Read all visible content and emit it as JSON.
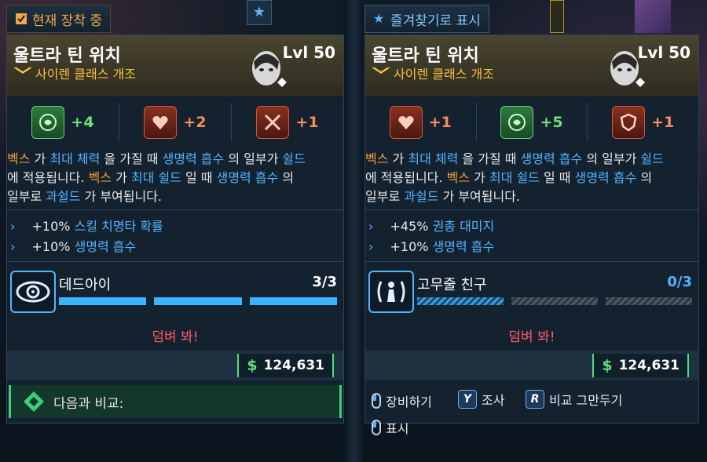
{
  "tabs": {
    "left": "현재 장착 중",
    "right": "즐겨찾기로 표시"
  },
  "left": {
    "title": "울트라 틴 위치",
    "level": "Lvl 50",
    "subtitle": "사이렌 클래스 개조",
    "stats": [
      {
        "icon": "lifesteal-icon",
        "value": "+4",
        "color": "green"
      },
      {
        "icon": "heart-boost-icon",
        "value": "+2",
        "color": "red"
      },
      {
        "icon": "crossed-weapons-icon",
        "value": "+1",
        "color": "red"
      }
    ],
    "description": {
      "t1": "벡스",
      "t2": " 가 ",
      "t3": "최대 체력",
      "t4": " 을 가질 때 ",
      "t5": "생명력 흡수",
      "t6": " 의 일부가 ",
      "t7": "쉴드",
      "t8": "에 적용됩니다. ",
      "t9": "벡스",
      "t10": " 가 ",
      "t11": "최대 쉴드",
      "t12": " 일 때 ",
      "t13": "생명력 흡수",
      "t14": " 의",
      "t15": "일부로 ",
      "t16": "과쉴드",
      "t17": " 가 부여됩니다."
    },
    "bonuses": [
      {
        "prefix": "+10% ",
        "name": "스킬 치명타 확률"
      },
      {
        "prefix": "+10% ",
        "name": "생명력 흡수"
      }
    ],
    "skill": {
      "icon": "eye-target-icon",
      "name": "데드아이",
      "count": "3/3",
      "filled": 3,
      "total": 3
    },
    "taunt": "덤벼 봐!",
    "price": "124,631",
    "currency": "$",
    "compare": "다음과 비교:"
  },
  "right": {
    "title": "울트라 틴 위치",
    "level": "Lvl 50",
    "subtitle": "사이렌 클래스 개조",
    "stats": [
      {
        "icon": "heart-boost-icon",
        "value": "+1",
        "color": "red"
      },
      {
        "icon": "lifesteal-icon",
        "value": "+5",
        "color": "green"
      },
      {
        "icon": "shield-boost-icon",
        "value": "+1",
        "color": "red"
      }
    ],
    "description": {
      "t1": "벡스",
      "t2": " 가 ",
      "t3": "최대 체력",
      "t4": " 을 가질 때 ",
      "t5": "생명력 흡수",
      "t6": " 의 일부가 ",
      "t7": "쉴드",
      "t8": "에 적용됩니다. ",
      "t9": "벡스",
      "t10": " 가 ",
      "t11": "최대 쉴드",
      "t12": " 일 때 ",
      "t13": "생명력 흡수",
      "t14": " 의",
      "t15": "일부로 ",
      "t16": "과쉴드",
      "t17": " 가 부여됩니다."
    },
    "bonuses": [
      {
        "prefix": "+45% ",
        "name": "권총 대미지"
      },
      {
        "prefix": "+10% ",
        "name": "생명력 흡수"
      }
    ],
    "skill": {
      "icon": "person-signal-icon",
      "name": "고무줄 친구",
      "count": "0/3",
      "filled": 0,
      "total": 3
    },
    "taunt": "덤벼 봐!",
    "price": "124,631",
    "currency": "$",
    "controls": {
      "equip": "장비하기",
      "inspect_key": "Y",
      "inspect": "조사",
      "stop_key": "R",
      "stop": "비교 그만두기",
      "mark": "표시"
    }
  }
}
